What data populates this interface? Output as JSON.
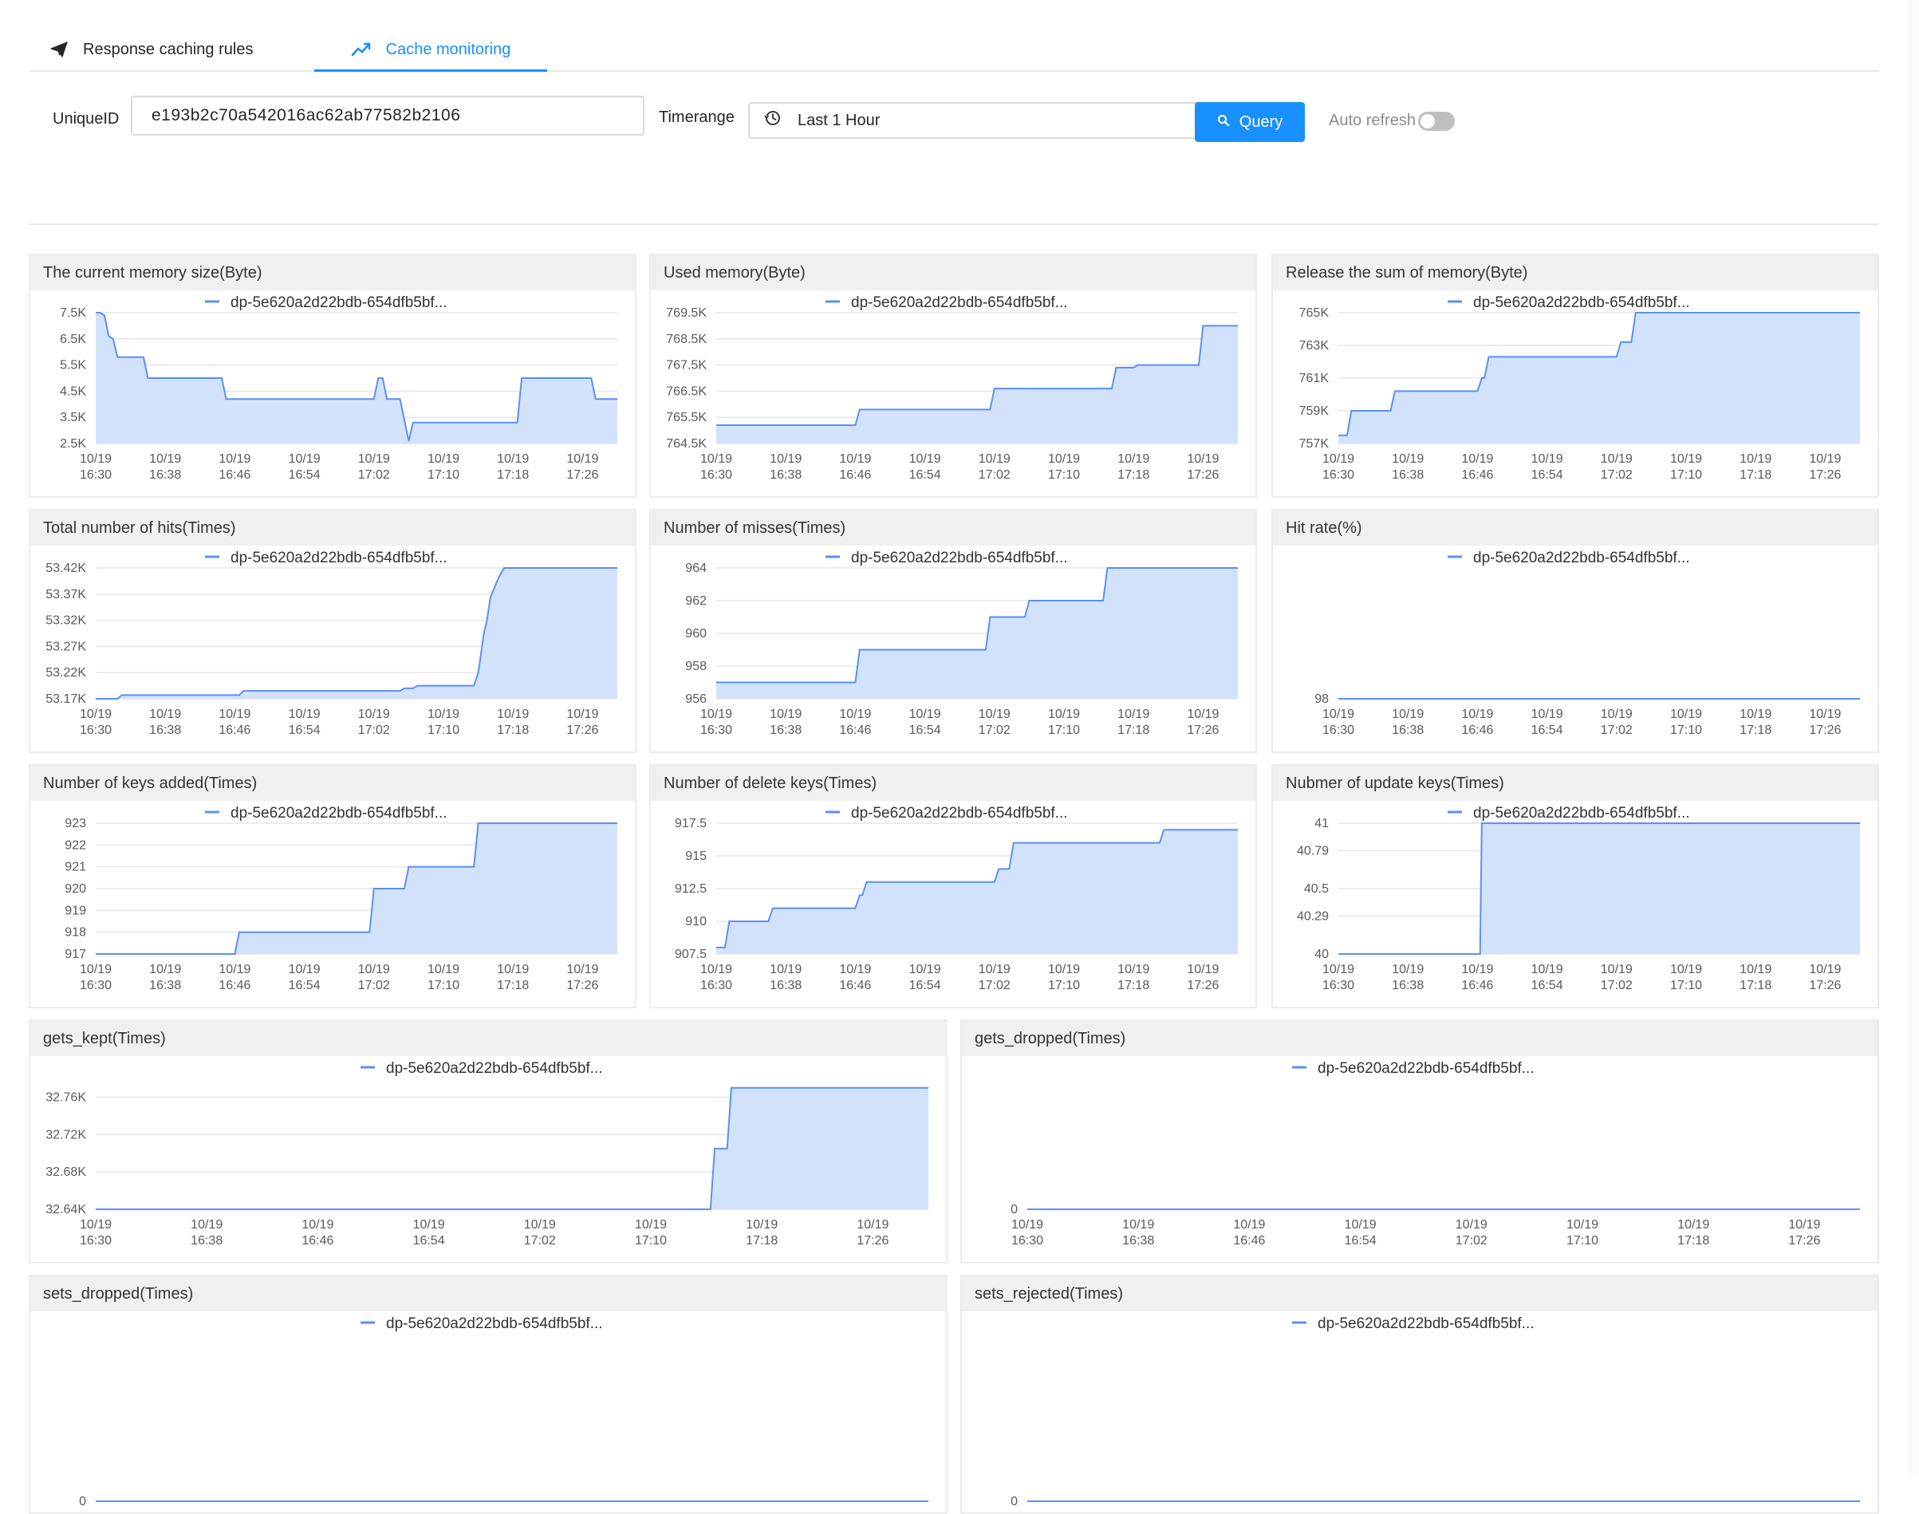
{
  "tabs": [
    {
      "label": "Response caching rules",
      "icon": "send-icon",
      "active": false
    },
    {
      "label": "Cache monitoring",
      "icon": "line-chart-icon",
      "active": true
    }
  ],
  "filters": {
    "uniqueid_label": "UniqueID",
    "uniqueid_value": "e193b2c70a542016ac62ab77582b2106",
    "timerange_label": "Timerange",
    "timerange_value": "Last 1 Hour",
    "query_label": "Query",
    "auto_refresh_label": "Auto refresh",
    "auto_refresh_on": false
  },
  "colors": {
    "accent": "#1890ff",
    "series_line": "#5b8ff9",
    "series_fill": "#d3e2fb"
  },
  "chart_data": [
    {
      "type": "area",
      "title": "The current memory size(Byte)",
      "series": [
        {
          "name": "dp-5e620a2d22bdb-654dfb5bf...",
          "x": [
            0,
            0.5,
            1,
            1.5,
            2,
            2.5,
            3,
            3.5,
            4,
            4.5,
            5,
            5.5,
            6,
            6.5,
            7,
            7.5,
            8,
            8.5,
            9,
            9.5,
            10,
            10.5,
            11,
            11.5,
            12,
            12.5,
            13,
            13.5,
            14,
            14.5,
            15,
            15.5,
            16,
            16.5,
            17,
            17.5,
            18,
            18.5,
            19,
            19.5,
            20,
            20.5,
            21,
            21.5,
            22,
            22.5,
            23,
            23.5,
            24,
            24.5,
            25,
            25.5,
            26,
            26.5,
            27,
            27.5,
            28,
            28.5,
            29,
            29.5,
            30,
            30.5,
            31,
            31.5,
            32,
            32.5,
            33,
            33.5,
            34,
            34.5,
            35,
            35.5,
            36,
            36.5,
            37,
            37.5,
            38,
            38.5,
            39,
            39.5,
            40,
            40.5,
            41,
            41.5,
            42,
            42.5,
            43,
            43.5,
            44,
            44.5,
            45,
            45.5,
            46,
            46.5,
            47,
            47.5,
            48,
            48.5,
            49,
            49.5,
            50,
            50.5,
            51,
            51.5,
            52,
            52.5,
            53,
            53.5,
            54,
            54.5,
            55,
            55.5,
            56,
            56.5,
            57,
            57.5,
            58,
            58.5,
            59,
            59.5,
            60
          ],
          "values": [
            7500,
            7500,
            7400,
            6600,
            6500,
            5800,
            5800,
            5800,
            5800,
            5800,
            5800,
            5800,
            5000,
            5000,
            5000,
            5000,
            5000,
            5000,
            5000,
            5000,
            5000,
            5000,
            5000,
            5000,
            5000,
            5000,
            5000,
            5000,
            5000,
            5000,
            4200,
            4200,
            4200,
            4200,
            4200,
            4200,
            4200,
            4200,
            4200,
            4200,
            4200,
            4200,
            4200,
            4200,
            4200,
            4200,
            4200,
            4200,
            4200,
            4200,
            4200,
            4200,
            4200,
            4200,
            4200,
            4200,
            4200,
            4200,
            4200,
            4200,
            4200,
            4200,
            4200,
            4200,
            4200,
            5000,
            5000,
            4200,
            4200,
            4200,
            4200,
            3400,
            2600,
            3300,
            3300,
            3300,
            3300,
            3300,
            3300,
            3300,
            3300,
            3300,
            3300,
            3300,
            3300,
            3300,
            3300,
            3300,
            3300,
            3300,
            3300,
            3300,
            3300,
            3300,
            3300,
            3300,
            3300,
            3300,
            5000,
            5000,
            5000,
            5000,
            5000,
            5000,
            5000,
            5000,
            5000,
            5000,
            5000,
            5000,
            5000,
            5000,
            5000,
            5000,
            5000,
            4200,
            4200,
            4200,
            4200,
            4200,
            4200
          ]
        }
      ],
      "xticks": [
        "10/19\n16:30",
        "10/19\n16:38",
        "10/19\n16:46",
        "10/19\n16:54",
        "10/19\n17:02",
        "10/19\n17:10",
        "10/19\n17:18",
        "10/19\n17:26"
      ],
      "ylim": [
        2500,
        7500
      ],
      "yticks": [
        2500,
        3500,
        4500,
        5500,
        6500,
        7500
      ],
      "ytick_labels": [
        "2.5K",
        "3.5K",
        "4.5K",
        "5.5K",
        "6.5K",
        "7.5K"
      ]
    },
    {
      "type": "area",
      "title": "Used memory(Byte)",
      "series": [
        {
          "name": "dp-5e620a2d22bdb-654dfb5bf...",
          "x": [
            0,
            16,
            16.5,
            31.5,
            32,
            45.5,
            46,
            48,
            48.5,
            55.5,
            56,
            60
          ],
          "values": [
            765200,
            765200,
            765800,
            765800,
            766600,
            766600,
            767400,
            767400,
            767500,
            767500,
            769000,
            769000
          ]
        }
      ],
      "xticks": [
        "10/19\n16:30",
        "10/19\n16:38",
        "10/19\n16:46",
        "10/19\n16:54",
        "10/19\n17:02",
        "10/19\n17:10",
        "10/19\n17:18",
        "10/19\n17:26"
      ],
      "ylim": [
        764500,
        769500
      ],
      "yticks": [
        764500,
        765500,
        766500,
        767500,
        768500,
        769500
      ],
      "ytick_labels": [
        "764.5K",
        "765.5K",
        "766.5K",
        "767.5K",
        "768.5K",
        "769.5K"
      ]
    },
    {
      "type": "area",
      "title": "Release the sum of memory(Byte)",
      "series": [
        {
          "name": "dp-5e620a2d22bdb-654dfb5bf...",
          "x": [
            0,
            1,
            1.5,
            6,
            6.5,
            16,
            16.5,
            16.8,
            17.3,
            32,
            32.5,
            33.7,
            34.2,
            51,
            51.5,
            60
          ],
          "values": [
            757500,
            757500,
            759000,
            759000,
            760200,
            760200,
            761000,
            761000,
            762300,
            762300,
            763200,
            763200,
            765000,
            765000,
            765500,
            765500
          ]
        }
      ],
      "xticks": [
        "10/19\n16:30",
        "10/19\n16:38",
        "10/19\n16:46",
        "10/19\n16:54",
        "10/19\n17:02",
        "10/19\n17:10",
        "10/19\n17:18",
        "10/19\n17:26"
      ],
      "ylim": [
        757000,
        765000
      ],
      "yticks": [
        757000,
        759000,
        761000,
        763000,
        765000
      ],
      "ytick_labels": [
        "757K",
        "759K",
        "761K",
        "763K",
        "765K"
      ]
    },
    {
      "type": "area",
      "title": "Total number of hits(Times)",
      "series": [
        {
          "name": "dp-5e620a2d22bdb-654dfb5bf...",
          "x": [
            0,
            2.5,
            3,
            16.5,
            17,
            35,
            35.5,
            36.5,
            37,
            43.5,
            44,
            44.2,
            44.6,
            45,
            45.4,
            45.8,
            46.2,
            46.6,
            47,
            60
          ],
          "values": [
            53170,
            53170,
            53177,
            53177,
            53185,
            53185,
            53190,
            53190,
            53195,
            53195,
            53220,
            53242,
            53290,
            53320,
            53364,
            53380,
            53396,
            53410,
            53420,
            53420
          ]
        }
      ],
      "xticks": [
        "10/19\n16:30",
        "10/19\n16:38",
        "10/19\n16:46",
        "10/19\n16:54",
        "10/19\n17:02",
        "10/19\n17:10",
        "10/19\n17:18",
        "10/19\n17:26"
      ],
      "ylim": [
        53170,
        53420
      ],
      "yticks": [
        53170,
        53220,
        53270,
        53320,
        53370,
        53420
      ],
      "ytick_labels": [
        "53.17K",
        "53.22K",
        "53.27K",
        "53.32K",
        "53.37K",
        "53.42K"
      ]
    },
    {
      "type": "area",
      "title": "Number of misses(Times)",
      "series": [
        {
          "name": "dp-5e620a2d22bdb-654dfb5bf...",
          "x": [
            0,
            16,
            16.5,
            31,
            31.5,
            35.5,
            36,
            44.5,
            45,
            60
          ],
          "values": [
            957,
            957,
            959,
            959,
            961,
            961,
            962,
            962,
            964,
            964
          ]
        }
      ],
      "xticks": [
        "10/19\n16:30",
        "10/19\n16:38",
        "10/19\n16:46",
        "10/19\n16:54",
        "10/19\n17:02",
        "10/19\n17:10",
        "10/19\n17:18",
        "10/19\n17:26"
      ],
      "ylim": [
        956,
        964
      ],
      "yticks": [
        956,
        958,
        960,
        962,
        964
      ],
      "ytick_labels": [
        "956",
        "958",
        "960",
        "962",
        "964"
      ]
    },
    {
      "type": "line",
      "title": "Hit rate(%)",
      "series": [
        {
          "name": "dp-5e620a2d22bdb-654dfb5bf...",
          "x": [
            0,
            60
          ],
          "values": [
            98,
            98
          ]
        }
      ],
      "xticks": [
        "10/19\n16:30",
        "10/19\n16:38",
        "10/19\n16:46",
        "10/19\n16:54",
        "10/19\n17:02",
        "10/19\n17:10",
        "10/19\n17:18",
        "10/19\n17:26"
      ],
      "ylim": [
        98,
        100
      ],
      "yticks": [
        98
      ],
      "ytick_labels": [
        "98"
      ]
    },
    {
      "type": "area",
      "title": "Number of keys added(Times)",
      "series": [
        {
          "name": "dp-5e620a2d22bdb-654dfb5bf...",
          "x": [
            0,
            16,
            16.5,
            31.5,
            32,
            35.5,
            36,
            43.5,
            44,
            60
          ],
          "values": [
            917,
            917,
            918,
            918,
            920,
            920,
            921,
            921,
            923,
            923
          ]
        }
      ],
      "xticks": [
        "10/19\n16:30",
        "10/19\n16:38",
        "10/19\n16:46",
        "10/19\n16:54",
        "10/19\n17:02",
        "10/19\n17:10",
        "10/19\n17:18",
        "10/19\n17:26"
      ],
      "ylim": [
        917,
        923
      ],
      "yticks": [
        917,
        918,
        919,
        920,
        921,
        922,
        923
      ],
      "ytick_labels": [
        "917",
        "918",
        "919",
        "920",
        "921",
        "922",
        "923"
      ]
    },
    {
      "type": "area",
      "title": "Number of delete keys(Times)",
      "series": [
        {
          "name": "dp-5e620a2d22bdb-654dfb5bf...",
          "x": [
            0,
            1,
            1.5,
            6,
            6.5,
            16,
            16.5,
            16.8,
            17.3,
            32,
            32.5,
            33.7,
            34.2,
            51,
            51.5,
            60
          ],
          "values": [
            908,
            908,
            910,
            910,
            911,
            911,
            912,
            912,
            913,
            913,
            914,
            914,
            916,
            916,
            917,
            917
          ]
        }
      ],
      "xticks": [
        "10/19\n16:30",
        "10/19\n16:38",
        "10/19\n16:46",
        "10/19\n16:54",
        "10/19\n17:02",
        "10/19\n17:10",
        "10/19\n17:18",
        "10/19\n17:26"
      ],
      "ylim": [
        907.5,
        917.5
      ],
      "yticks": [
        907.5,
        910,
        912.5,
        915,
        917.5
      ],
      "ytick_labels": [
        "907.5",
        "910",
        "912.5",
        "915",
        "917.5"
      ]
    },
    {
      "type": "area",
      "title": "Nubmer of update keys(Times)",
      "series": [
        {
          "name": "dp-5e620a2d22bdb-654dfb5bf...",
          "x": [
            0,
            16.3,
            16.5,
            60
          ],
          "values": [
            40,
            40,
            41,
            41
          ]
        }
      ],
      "xticks": [
        "10/19\n16:30",
        "10/19\n16:38",
        "10/19\n16:46",
        "10/19\n16:54",
        "10/19\n17:02",
        "10/19\n17:10",
        "10/19\n17:18",
        "10/19\n17:26"
      ],
      "ylim": [
        40,
        41
      ],
      "yticks": [
        40,
        40.29,
        40.5,
        40.79,
        41
      ],
      "ytick_labels": [
        "40",
        "40.29",
        "40.5",
        "40.79",
        "41"
      ]
    },
    {
      "type": "area",
      "title": "gets_kept(Times)",
      "series": [
        {
          "name": "dp-5e620a2d22bdb-654dfb5bf...",
          "x": [
            0,
            44.3,
            44.6,
            45.5,
            45.8,
            60
          ],
          "values": [
            32640,
            32640,
            32705,
            32705,
            32770,
            32770
          ]
        }
      ],
      "xticks": [
        "10/19\n16:30",
        "10/19\n16:38",
        "10/19\n16:46",
        "10/19\n16:54",
        "10/19\n17:02",
        "10/19\n17:10",
        "10/19\n17:18",
        "10/19\n17:26"
      ],
      "ylim": [
        32640,
        32780
      ],
      "yticks": [
        32640,
        32680,
        32720,
        32760
      ],
      "ytick_labels": [
        "32.64K",
        "32.68K",
        "32.72K",
        "32.76K"
      ]
    },
    {
      "type": "line",
      "title": "gets_dropped(Times)",
      "series": [
        {
          "name": "dp-5e620a2d22bdb-654dfb5bf...",
          "x": [
            0,
            60
          ],
          "values": [
            0,
            0
          ]
        }
      ],
      "xticks": [
        "10/19\n16:30",
        "10/19\n16:38",
        "10/19\n16:46",
        "10/19\n16:54",
        "10/19\n17:02",
        "10/19\n17:10",
        "10/19\n17:18",
        "10/19\n17:26"
      ],
      "ylim": [
        0,
        1
      ],
      "yticks": [
        0
      ],
      "ytick_labels": [
        "0"
      ]
    },
    {
      "type": "line",
      "title": "sets_dropped(Times)",
      "series": [
        {
          "name": "dp-5e620a2d22bdb-654dfb5bf...",
          "x": [
            0,
            60
          ],
          "values": [
            0,
            0
          ]
        }
      ],
      "xticks": [],
      "ylim": [
        0,
        1
      ],
      "yticks": [
        0
      ],
      "ytick_labels": [
        "0"
      ]
    },
    {
      "type": "line",
      "title": "sets_rejected(Times)",
      "series": [
        {
          "name": "dp-5e620a2d22bdb-654dfb5bf...",
          "x": [
            0,
            60
          ],
          "values": [
            0,
            0
          ]
        }
      ],
      "xticks": [],
      "ylim": [
        0,
        1
      ],
      "yticks": [
        0
      ],
      "ytick_labels": [
        "0"
      ]
    }
  ]
}
